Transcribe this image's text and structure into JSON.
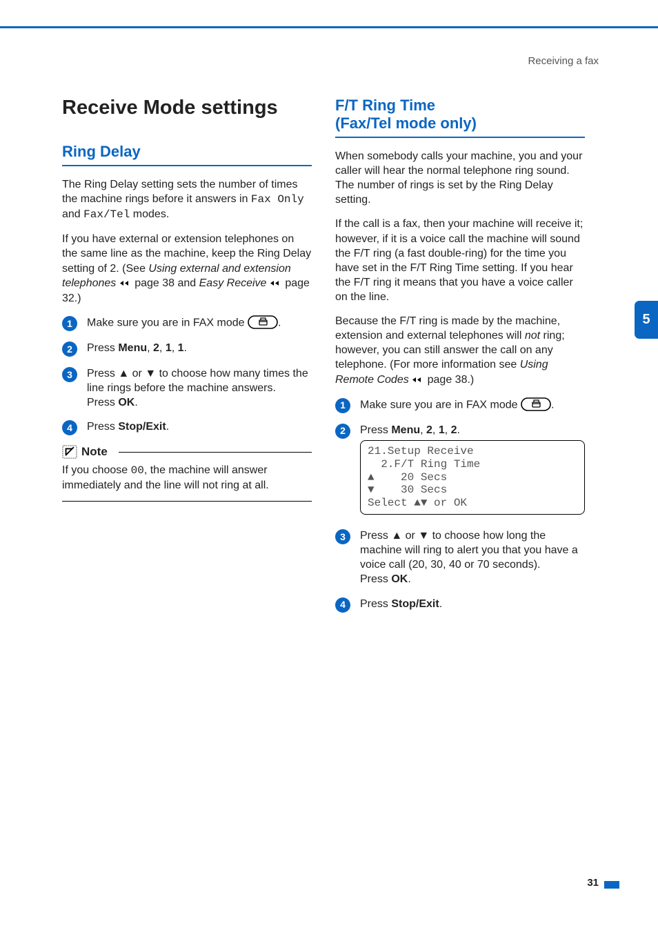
{
  "header": {
    "breadcrumb": "Receiving a fax"
  },
  "title": "Receive Mode settings",
  "left": {
    "heading": "Ring Delay",
    "p1_a": "The Ring Delay setting sets the number of times the machine rings before it answers in ",
    "p1_mono1": "Fax Only",
    "p1_b": " and ",
    "p1_mono2": "Fax/Tel",
    "p1_c": " modes.",
    "p2_a": "If you have external or extension telephones on the same line as the machine, keep the Ring Delay setting of 2. (See ",
    "p2_i1": "Using external and extension telephones",
    "p2_b": " page 38 and ",
    "p2_i2": "Easy Receive",
    "p2_c": " page 32.)",
    "steps": [
      {
        "n": "1",
        "a": "Make sure you are in FAX mode ",
        "b": "."
      },
      {
        "n": "2",
        "a": "Press ",
        "bold1": "Menu",
        "b": ", ",
        "bold2": "2",
        "c": ", ",
        "bold3": "1",
        "d": ", ",
        "bold4": "1",
        "e": "."
      },
      {
        "n": "3",
        "a": "Press ",
        "arrup": "a",
        "b": " or ",
        "arrdn": "b",
        "c": " to choose how many times the line rings before the machine answers.",
        "d": "Press ",
        "bold1": "OK",
        "e": "."
      },
      {
        "n": "4",
        "a": "Press ",
        "bold1": "Stop/Exit",
        "b": "."
      }
    ],
    "note": {
      "label": "Note",
      "body_a": "If you choose ",
      "body_mono": "00",
      "body_b": ", the machine will answer immediately and the line will not ring at all."
    }
  },
  "right": {
    "heading_l1": "F/T Ring Time",
    "heading_l2": "(Fax/Tel mode only)",
    "p1": "When somebody calls your machine, you and your caller will hear the normal telephone ring sound. The number of rings is set by the Ring Delay setting.",
    "p2": "If the call is a fax, then your machine will receive it; however, if it is a voice call the machine will sound the F/T ring (a fast double-ring) for the time you have set in the F/T Ring Time setting. If you hear the F/T ring it means that you have a voice caller on the line.",
    "p3_a": "Because the F/T ring is made by the machine, extension and external telephones will ",
    "p3_i": "not",
    "p3_b": " ring; however, you can still answer the call on any telephone. (For more information see ",
    "p3_i2": "Using Remote Codes",
    "p3_c": " page 38.)",
    "steps": [
      {
        "n": "1",
        "a": "Make sure you are in FAX mode ",
        "b": "."
      },
      {
        "n": "2",
        "a": "Press ",
        "bold1": "Menu",
        "b": ", ",
        "bold2": "2",
        "c": ", ",
        "bold3": "1",
        "d": ", ",
        "bold4": "2",
        "e": "."
      }
    ],
    "lcd": "21.Setup Receive\n  2.F/T Ring Time\na    20 Secs\nb    30 Secs\nSelect ab or OK",
    "lcd_lines": {
      "l1": "21.Setup Receive",
      "l2": "  2.F/T Ring Time",
      "l3": "▲    20 Secs",
      "l4": "▼    30 Secs",
      "l5": "Select ▲▼ or OK"
    },
    "steps2": [
      {
        "n": "3",
        "a": "Press ",
        "arrup": "a",
        "b": " or ",
        "arrdn": "b",
        "c": " to choose how long the machine will ring to alert you that you have a voice call (20, 30, 40 or 70 seconds).",
        "d": "Press ",
        "bold1": "OK",
        "e": "."
      },
      {
        "n": "4",
        "a": "Press ",
        "bold1": "Stop/Exit",
        "b": "."
      }
    ]
  },
  "side_tab": "5",
  "page_number": "31"
}
